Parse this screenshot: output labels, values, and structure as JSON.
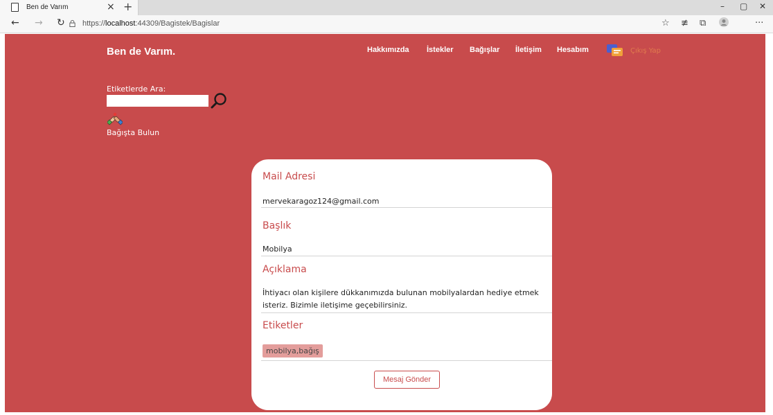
{
  "browser": {
    "tab_title": "Ben de Varım",
    "url_prefix": "https://",
    "url_host": "localhost",
    "url_rest": ":44309/Bagistek/Bagislar"
  },
  "header": {
    "brand": "Ben de Varım.",
    "nav": [
      "Hakkımızda",
      "İstekler",
      "Bağışlar",
      "İletişim",
      "Hesabım"
    ],
    "logout": "Çıkış Yap"
  },
  "search": {
    "label": "Etiketlerde Ara:",
    "value": "",
    "donate_link": "Bağışta Bulun"
  },
  "form": {
    "mail_label": "Mail Adresi",
    "mail_value": "mervekaragoz124@gmail.com",
    "title_label": "Başlık",
    "title_value": "Mobilya",
    "desc_label": "Açıklama",
    "desc_line1": "İhtiyacı olan kişilere dükkanımızda bulunan mobilyalardan hediye etmek",
    "desc_line2": "isteriz. Bizimle iletişime geçebilirsiniz.",
    "tags_label": "Etiketler",
    "tags_value": "mobilya,bağış",
    "send_button": "Mesaj Gönder"
  },
  "colors": {
    "brand_red": "#c84b4c",
    "tag_bg": "#e39d9b"
  }
}
